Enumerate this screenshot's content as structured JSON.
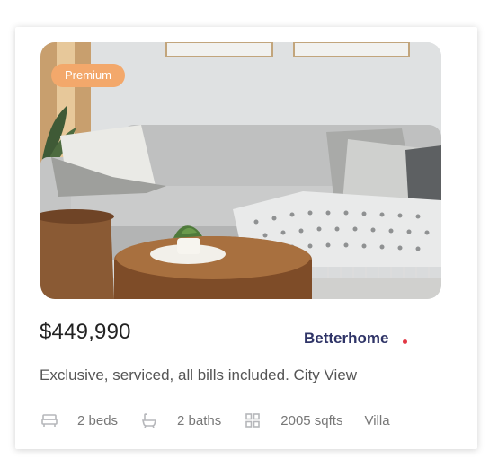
{
  "card": {
    "badge": "Premium",
    "price": "$449,990",
    "brand": "Betterhome",
    "description": "Exclusive, serviced, all bills included. City View",
    "features": {
      "beds": "2 beds",
      "baths": "2 baths",
      "area": "2005 sqfts",
      "type": "Villa"
    },
    "icons": [
      "bed-icon",
      "bath-icon",
      "area-icon"
    ],
    "colors": {
      "badge": "#f3a86b",
      "brand": "#2f3467",
      "brand_dot": "#e23744"
    }
  }
}
